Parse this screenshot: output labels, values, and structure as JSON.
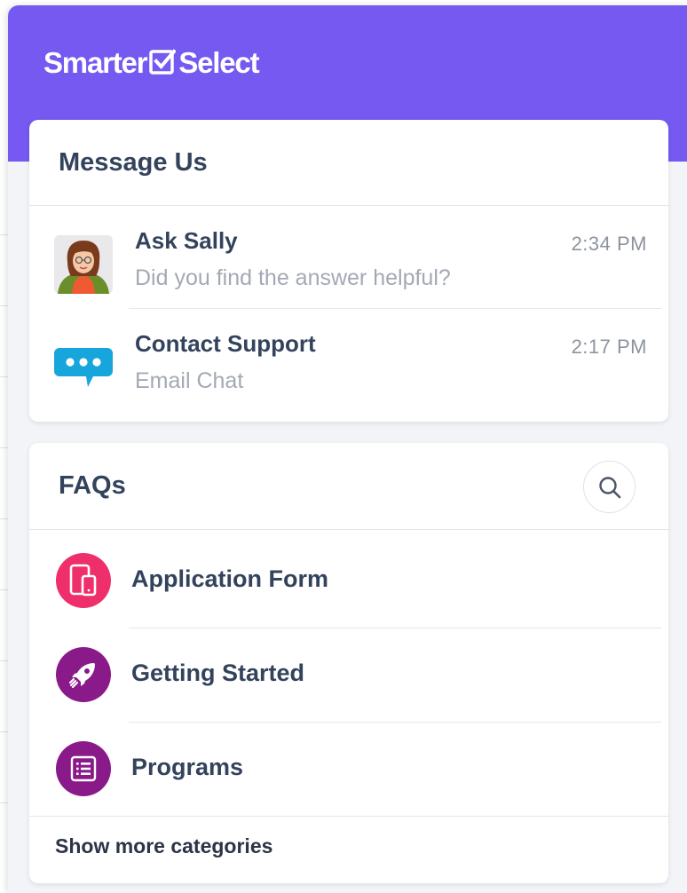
{
  "brand": {
    "logo_left": "Smarter",
    "logo_right": "Select",
    "header_color": "#7559f0"
  },
  "message_us": {
    "title": "Message Us",
    "conversations": [
      {
        "name": "Ask Sally",
        "preview": "Did you find the answer helpful?",
        "time": "2:34 PM",
        "icon": "sally-avatar-icon"
      },
      {
        "name": "Contact Support",
        "preview": "Email Chat",
        "time": "2:17 PM",
        "icon": "chat-bubble-icon"
      }
    ]
  },
  "faqs": {
    "title": "FAQs",
    "search_icon": "search-icon",
    "categories": [
      {
        "label": "Application Form",
        "icon": "mobile-device-icon",
        "color": "#ee2f6b"
      },
      {
        "label": "Getting Started",
        "icon": "rocket-icon",
        "color": "#8a1a8a"
      },
      {
        "label": "Programs",
        "icon": "list-document-icon",
        "color": "#8a1a8a"
      }
    ],
    "show_more": "Show more categories"
  }
}
